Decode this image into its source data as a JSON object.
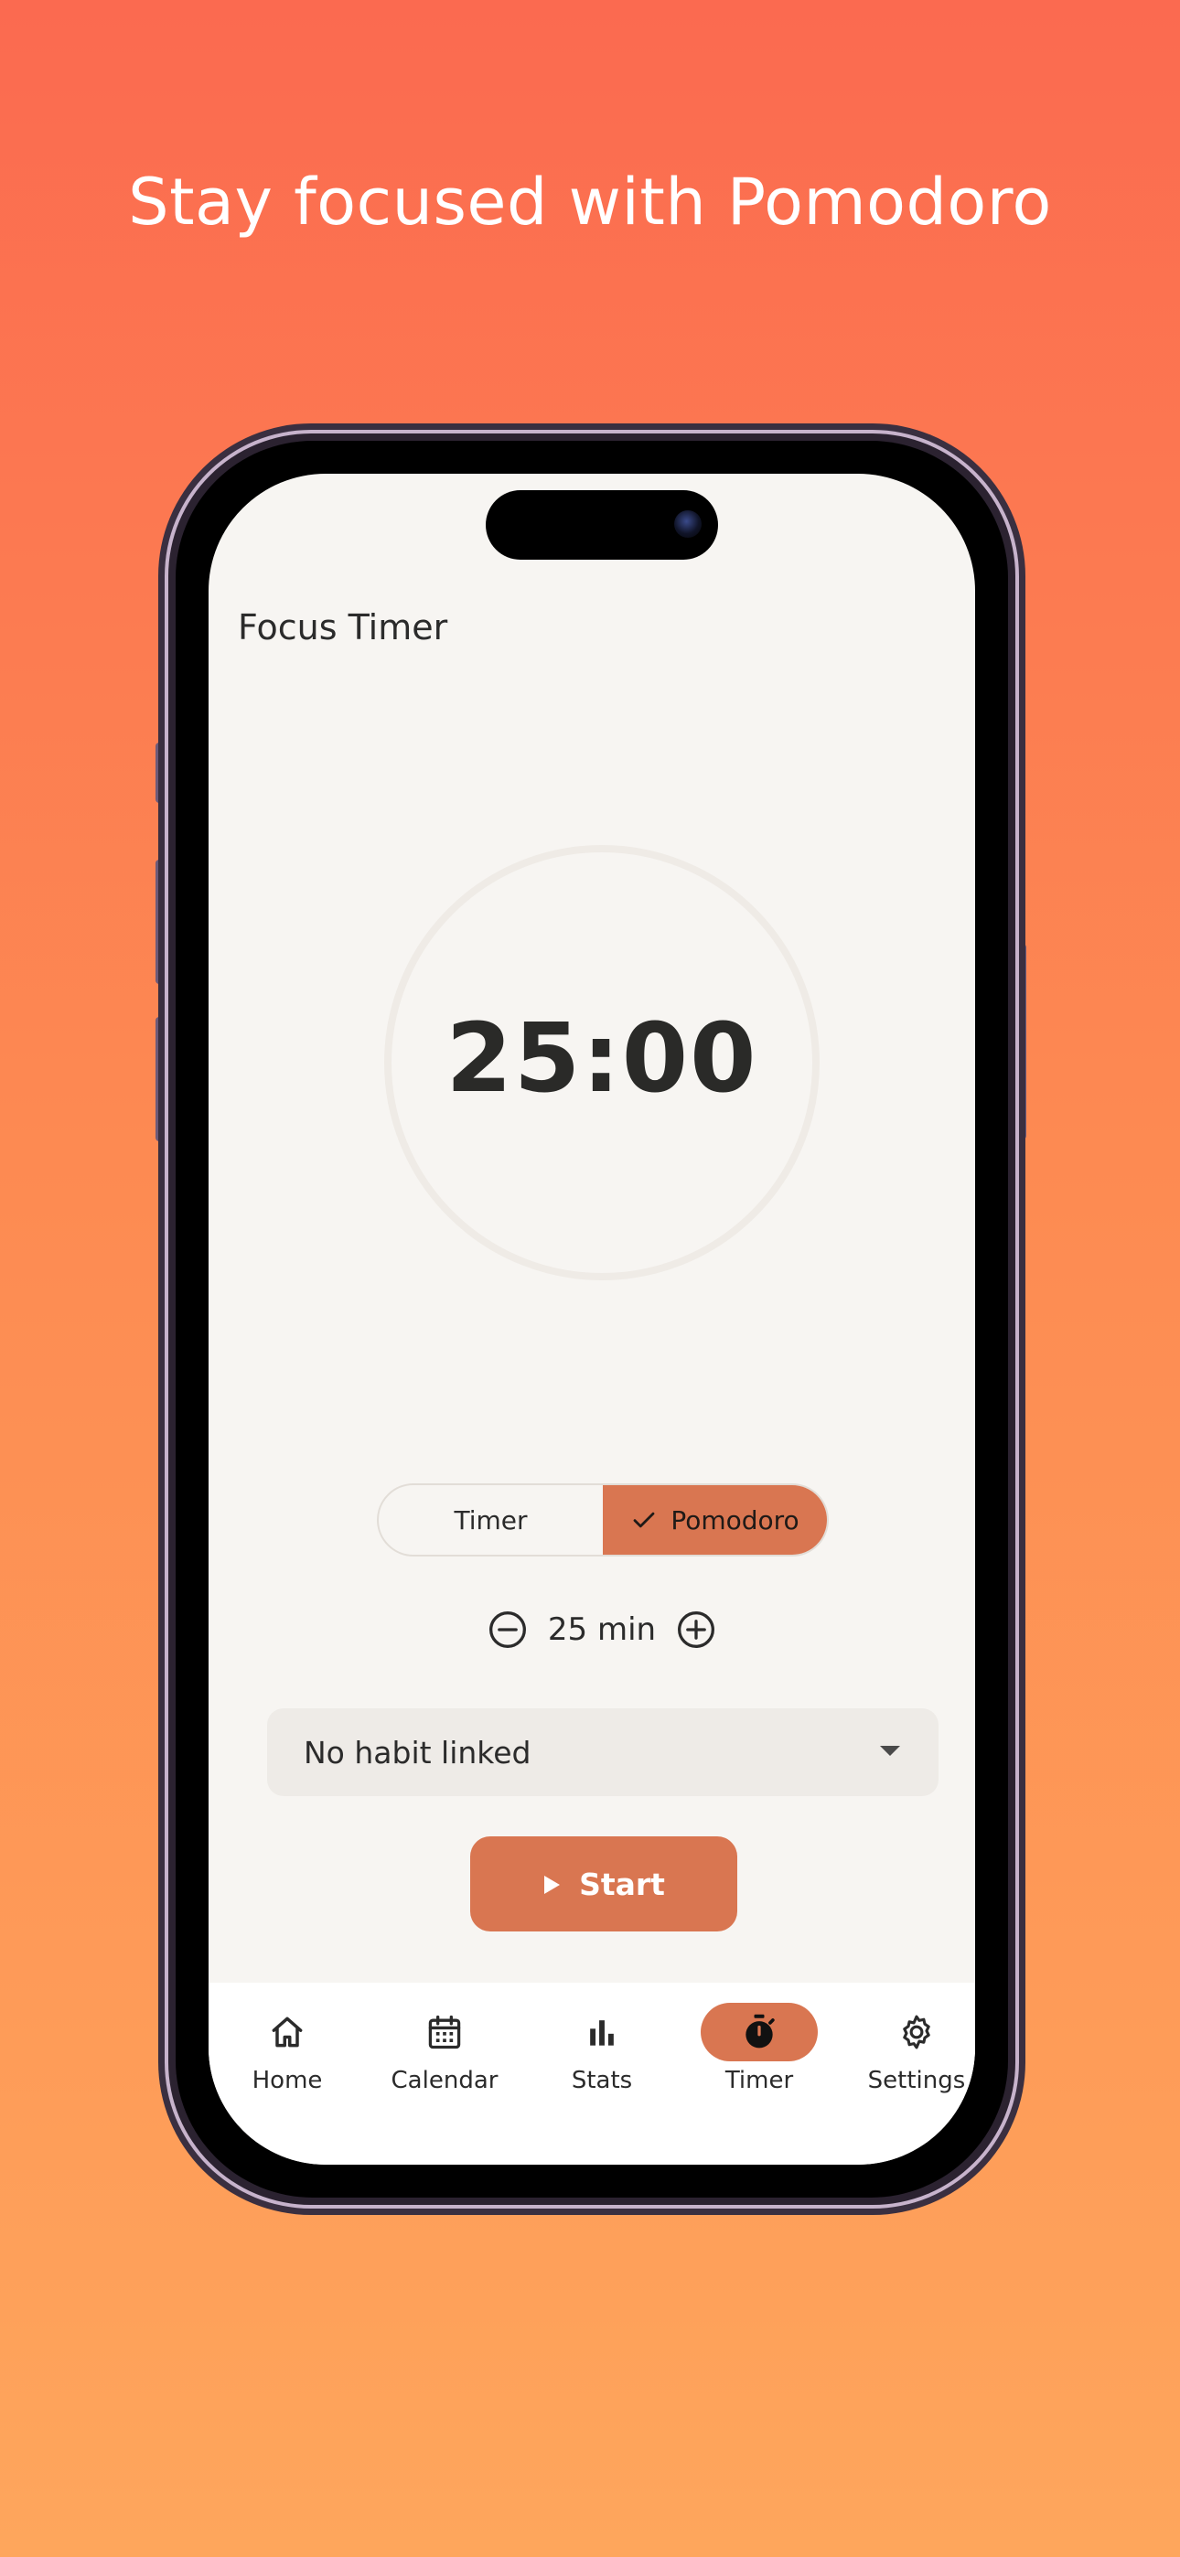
{
  "headline": "Stay focused with Pomodoro",
  "app": {
    "title": "Focus Timer",
    "timer_display": "25:00",
    "mode_toggle": {
      "options": [
        "Timer",
        "Pomodoro"
      ],
      "selected": "Pomodoro"
    },
    "duration": {
      "value_label": "25 min"
    },
    "habit_select": {
      "selected_label": "No habit linked"
    },
    "start_button": "Start"
  },
  "nav": {
    "items": [
      {
        "label": "Home",
        "icon": "home-icon"
      },
      {
        "label": "Calendar",
        "icon": "calendar-icon"
      },
      {
        "label": "Stats",
        "icon": "stats-icon"
      },
      {
        "label": "Timer",
        "icon": "stopwatch-icon",
        "active": true
      },
      {
        "label": "Settings",
        "icon": "gear-icon"
      }
    ]
  },
  "colors": {
    "accent": "#d97651",
    "background_top": "#fb6a50",
    "background_bottom": "#fea65c",
    "screen": "#f7f5f2"
  }
}
